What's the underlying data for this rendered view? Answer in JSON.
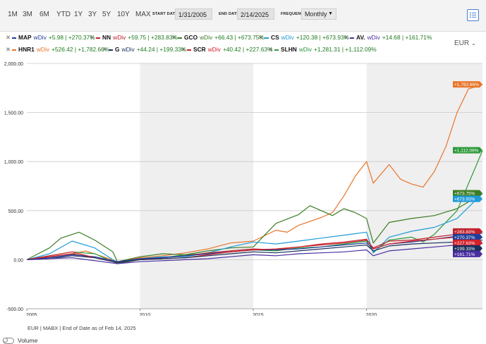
{
  "toolbar": {
    "ranges": [
      "1M",
      "3M",
      "6M",
      "YTD",
      "1Y",
      "3Y",
      "5Y",
      "10Y",
      "MAX"
    ],
    "start_label": "START DATE",
    "start_value": "1/31/2005",
    "end_label": "END DATE",
    "end_value": "2/14/2025",
    "frequency_label": "FREQUENCY",
    "frequency_value": "Monthly"
  },
  "currency": "EUR",
  "legend": [
    {
      "symbol": "MAP",
      "wdiv": "wDiv",
      "stats": "+5.98 | +270.37%",
      "color": "#1f3f9a"
    },
    {
      "symbol": "NN",
      "wdiv": "wDiv",
      "stats": "+59.75 | +283.83%",
      "color": "#c0202a"
    },
    {
      "symbol": "GCO",
      "wdiv": "wDiv",
      "stats": "+66.43 | +673.75%",
      "color": "#3c7d23"
    },
    {
      "symbol": "CS",
      "wdiv": "wDiv",
      "stats": "+120.38 | +673.93%",
      "color": "#1f9bd8"
    },
    {
      "symbol": "AV.",
      "wdiv": "wDiv",
      "stats": "+14.68 | +161.71%",
      "color": "#4a2fa0"
    },
    {
      "symbol": "HNR1",
      "wdiv": "wDiv",
      "stats": "+526.42 | +1,782.66%",
      "color": "#e8752a"
    },
    {
      "symbol": "G",
      "wdiv": "wDiv",
      "stats": "+44.24 | +199.33%",
      "color": "#1b2f5e"
    },
    {
      "symbol": "SCR",
      "wdiv": "wDiv",
      "stats": "+40.42 | +227.63%",
      "color": "#d4202a"
    },
    {
      "symbol": "SLHN",
      "wdiv": "wDiv",
      "stats": "+1,281.31 | +1,112.09%",
      "color": "#2e9a3c"
    }
  ],
  "chart_data": {
    "type": "line",
    "title": "",
    "ylim": [
      -500,
      2000
    ],
    "xlim": [
      2005.0,
      2025.12
    ],
    "y_ticks": [
      "2,000.00",
      "1,500.00",
      "1,000.00",
      "500.00",
      "0.00",
      "-500.00"
    ],
    "y_tick_values": [
      2000,
      1500,
      1000,
      500,
      0,
      -500
    ],
    "x_ticks": [
      "2005",
      "2010",
      "2015",
      "2020"
    ],
    "x_tick_values": [
      2005,
      2010,
      2015,
      2020
    ],
    "shaded_bands": [
      [
        2010,
        2015
      ],
      [
        2020,
        2025.12
      ]
    ],
    "series": [
      {
        "name": "HNR1",
        "color": "#e8752a",
        "end_label": "+1,782.66%",
        "x": [
          2005,
          2006,
          2007,
          2007.6,
          2008.5,
          2009,
          2010,
          2011,
          2012,
          2013,
          2014,
          2015,
          2016,
          2016.5,
          2017,
          2017.5,
          2018,
          2018.5,
          2019,
          2019.5,
          2020,
          2020.3,
          2021,
          2021.5,
          2022,
          2022.5,
          2023,
          2023.5,
          2024,
          2024.5,
          2025.12
        ],
        "y": [
          0,
          30,
          60,
          90,
          20,
          -20,
          20,
          40,
          70,
          110,
          170,
          190,
          300,
          280,
          350,
          390,
          430,
          480,
          650,
          850,
          1000,
          780,
          970,
          820,
          770,
          740,
          900,
          1150,
          1500,
          1740,
          1783
        ]
      },
      {
        "name": "SLHN",
        "color": "#2e9a3c",
        "end_label": "+1,112.09%",
        "x": [
          2005,
          2006,
          2007,
          2008,
          2009,
          2010,
          2011,
          2012,
          2013,
          2014,
          2015,
          2016,
          2017,
          2018,
          2019,
          2020,
          2020.3,
          2021,
          2022,
          2022.5,
          2023,
          2024,
          2025.12
        ],
        "y": [
          0,
          40,
          80,
          60,
          -40,
          0,
          20,
          50,
          60,
          80,
          100,
          90,
          120,
          130,
          160,
          190,
          80,
          200,
          230,
          180,
          260,
          500,
          1112
        ]
      },
      {
        "name": "GCO",
        "color": "#3c7d23",
        "end_label": "+673.75%",
        "x": [
          2005,
          2006,
          2006.5,
          2007.3,
          2008,
          2008.8,
          2009,
          2010,
          2011,
          2012,
          2013,
          2014,
          2015,
          2015.5,
          2016,
          2017,
          2017.5,
          2018,
          2018.5,
          2019,
          2019.5,
          2020,
          2020.3,
          2021,
          2022,
          2023,
          2024,
          2025.12
        ],
        "y": [
          0,
          120,
          220,
          280,
          200,
          80,
          -20,
          30,
          60,
          50,
          90,
          120,
          130,
          250,
          370,
          460,
          550,
          500,
          450,
          520,
          480,
          420,
          170,
          380,
          420,
          450,
          520,
          674
        ]
      },
      {
        "name": "CS",
        "color": "#1f9bd8",
        "end_label": "+673.93%",
        "x": [
          2005,
          2006,
          2007,
          2008,
          2009,
          2010,
          2011,
          2012,
          2013,
          2014,
          2015,
          2016,
          2017,
          2018,
          2019,
          2020,
          2020.3,
          2021,
          2022,
          2023,
          2024,
          2025.12
        ],
        "y": [
          0,
          60,
          190,
          120,
          -30,
          10,
          30,
          30,
          70,
          130,
          180,
          160,
          190,
          220,
          250,
          280,
          70,
          230,
          290,
          330,
          420,
          674
        ]
      },
      {
        "name": "NN",
        "color": "#c0202a",
        "end_label": "+283.83%",
        "x": [
          2005,
          2006,
          2007,
          2008,
          2009,
          2010,
          2011,
          2012,
          2013,
          2014,
          2015,
          2016,
          2017,
          2018,
          2019,
          2020,
          2020.3,
          2021,
          2022,
          2023,
          2024,
          2025.12
        ],
        "y": [
          0,
          30,
          60,
          20,
          -30,
          0,
          20,
          40,
          70,
          90,
          110,
          100,
          130,
          150,
          170,
          200,
          120,
          190,
          200,
          230,
          260,
          284
        ]
      },
      {
        "name": "MAP",
        "color": "#1f3f9a",
        "end_label": "+270.37%",
        "x": [
          2005,
          2006,
          2007,
          2008,
          2009,
          2010,
          2011,
          2012,
          2013,
          2014,
          2015,
          2016,
          2017,
          2018,
          2019,
          2020,
          2020.3,
          2021,
          2022,
          2023,
          2024,
          2025.12
        ],
        "y": [
          0,
          20,
          50,
          30,
          -20,
          10,
          20,
          40,
          60,
          80,
          100,
          100,
          110,
          130,
          150,
          170,
          110,
          160,
          180,
          210,
          240,
          270
        ]
      },
      {
        "name": "SCR",
        "color": "#d4202a",
        "end_label": "+227.63%",
        "x": [
          2005,
          2006,
          2007,
          2008,
          2009,
          2010,
          2011,
          2012,
          2013,
          2014,
          2015,
          2016,
          2017,
          2018,
          2019,
          2020,
          2020.3,
          2021,
          2022,
          2023,
          2024,
          2025.12
        ],
        "y": [
          0,
          40,
          80,
          20,
          -30,
          0,
          10,
          20,
          50,
          80,
          100,
          110,
          130,
          160,
          180,
          210,
          110,
          160,
          190,
          210,
          230,
          228
        ]
      },
      {
        "name": "G",
        "color": "#1b2f5e",
        "end_label": "+199.33%",
        "x": [
          2005,
          2006,
          2007,
          2008,
          2009,
          2010,
          2011,
          2012,
          2013,
          2014,
          2015,
          2016,
          2017,
          2018,
          2019,
          2020,
          2020.3,
          2021,
          2022,
          2023,
          2024,
          2025.12
        ],
        "y": [
          0,
          10,
          40,
          20,
          -30,
          0,
          10,
          20,
          40,
          60,
          80,
          70,
          90,
          110,
          130,
          150,
          90,
          140,
          160,
          170,
          180,
          199
        ]
      },
      {
        "name": "AV.",
        "color": "#4a2fa0",
        "end_label": "+161.71%",
        "x": [
          2005,
          2006,
          2007,
          2008,
          2009,
          2010,
          2011,
          2012,
          2013,
          2014,
          2015,
          2016,
          2017,
          2018,
          2019,
          2020,
          2020.3,
          2021,
          2022,
          2023,
          2024,
          2025.12
        ],
        "y": [
          0,
          10,
          20,
          -10,
          -40,
          -20,
          -10,
          0,
          10,
          30,
          50,
          40,
          60,
          70,
          80,
          100,
          40,
          90,
          110,
          130,
          150,
          162
        ]
      }
    ]
  },
  "footer": "EUR | MABX | End of Date as of Feb 14, 2025",
  "volume_label": "Volume"
}
